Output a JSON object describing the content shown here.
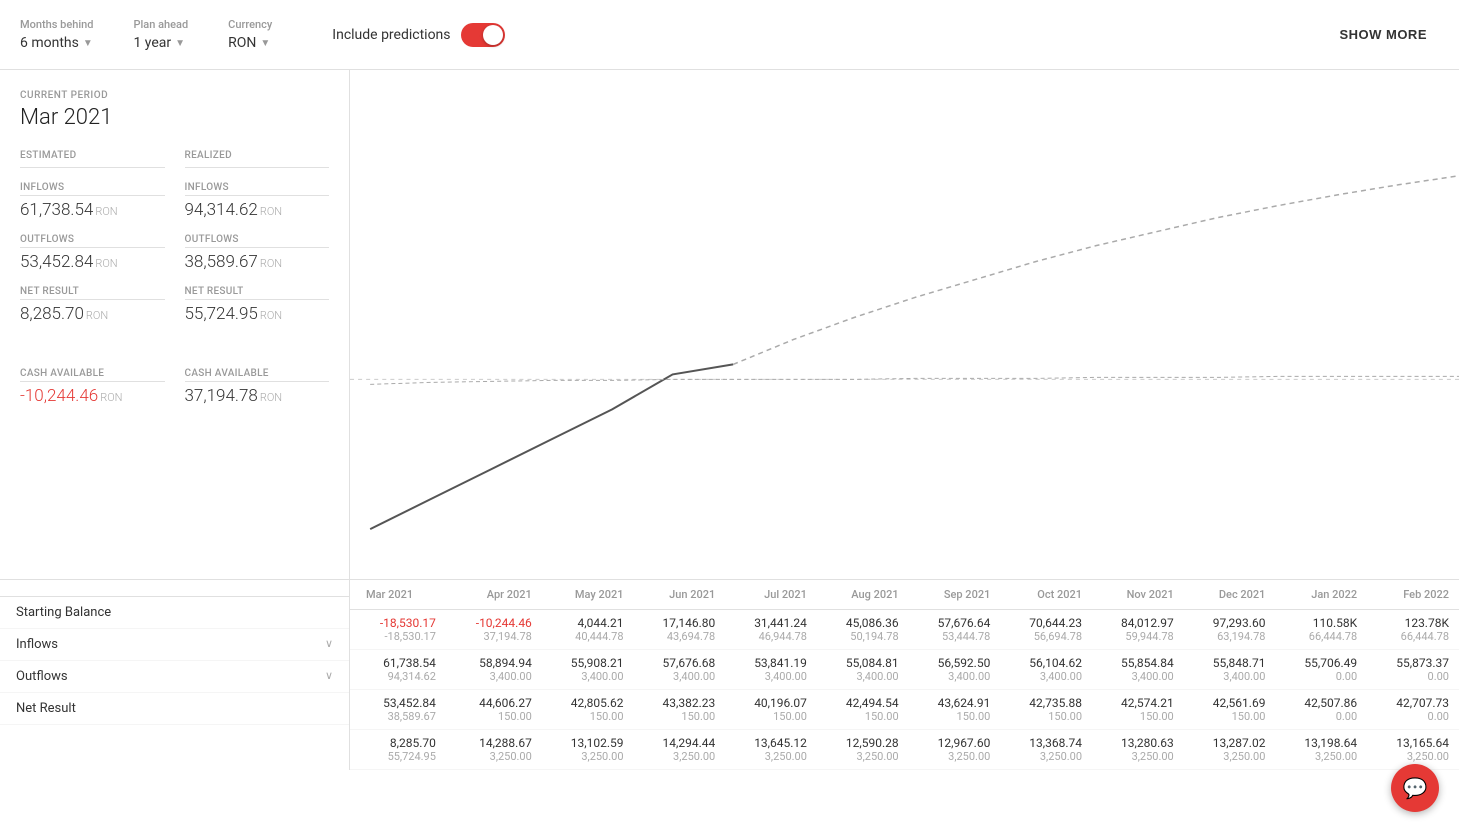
{
  "topbar": {
    "months_behind_label": "Months behind",
    "months_behind_value": "6 months",
    "plan_ahead_label": "Plan ahead",
    "plan_ahead_value": "1 year",
    "currency_label": "Currency",
    "currency_value": "RON",
    "include_predictions_label": "Include predictions",
    "show_more_label": "SHOW MORE"
  },
  "left_panel": {
    "current_period_label": "CURRENT PERIOD",
    "current_period_value": "Mar 2021",
    "estimated_label": "ESTIMATED",
    "realized_label": "REALIZED",
    "est_inflows_label": "INFLOWS",
    "est_inflows_value": "61,738.54",
    "est_inflows_currency": "RON",
    "est_outflows_label": "OUTFLOWS",
    "est_outflows_value": "53,452.84",
    "est_outflows_currency": "RON",
    "est_net_label": "NET RESULT",
    "est_net_value": "8,285.70",
    "est_net_currency": "RON",
    "est_cash_label": "CASH AVAILABLE",
    "est_cash_value": "-10,244.46",
    "est_cash_currency": "RON",
    "real_inflows_label": "INFLOWS",
    "real_inflows_value": "94,314.62",
    "real_inflows_currency": "RON",
    "real_outflows_label": "OUTFLOWS",
    "real_outflows_value": "38,589.67",
    "real_outflows_currency": "RON",
    "real_net_label": "NET RESULT",
    "real_net_value": "55,724.95",
    "real_net_currency": "RON",
    "real_cash_label": "CASH AVAILABLE",
    "real_cash_value": "37,194.78",
    "real_cash_currency": "RON"
  },
  "table": {
    "columns": [
      "Mar 2021",
      "Apr 2021",
      "May 2021",
      "Jun 2021",
      "Jul 2021",
      "Aug 2021",
      "Sep 2021",
      "Oct 2021",
      "Nov 2021",
      "Dec 2021",
      "Jan 2022",
      "Feb 2022"
    ],
    "rows": {
      "starting_balance": {
        "label": "Starting Balance",
        "data": [
          [
            "-18,530.17",
            "-18,530.17"
          ],
          [
            "-10,244.46",
            "37,194.78"
          ],
          [
            "4,044.21",
            "40,444.78"
          ],
          [
            "17,146.80",
            "43,694.78"
          ],
          [
            "31,441.24",
            "46,944.78"
          ],
          [
            "45,086.36",
            "50,194.78"
          ],
          [
            "57,676.64",
            "53,444.78"
          ],
          [
            "70,644.23",
            "56,694.78"
          ],
          [
            "84,012.97",
            "59,944.78"
          ],
          [
            "97,293.60",
            "63,194.78"
          ],
          [
            "110.58K",
            "66,444.78"
          ],
          [
            "123.78K",
            "66,444.78"
          ]
        ]
      },
      "inflows": {
        "label": "Inflows",
        "data": [
          [
            "61,738.54",
            "94,314.62"
          ],
          [
            "58,894.94",
            "3,400.00"
          ],
          [
            "55,908.21",
            "3,400.00"
          ],
          [
            "57,676.68",
            "3,400.00"
          ],
          [
            "53,841.19",
            "3,400.00"
          ],
          [
            "55,084.81",
            "3,400.00"
          ],
          [
            "56,592.50",
            "3,400.00"
          ],
          [
            "56,104.62",
            "3,400.00"
          ],
          [
            "55,854.84",
            "3,400.00"
          ],
          [
            "55,848.71",
            "3,400.00"
          ],
          [
            "55,706.49",
            "0.00"
          ],
          [
            "55,873.37",
            "0.00"
          ]
        ]
      },
      "outflows": {
        "label": "Outflows",
        "data": [
          [
            "53,452.84",
            "38,589.67"
          ],
          [
            "44,606.27",
            "150.00"
          ],
          [
            "42,805.62",
            "150.00"
          ],
          [
            "43,382.23",
            "150.00"
          ],
          [
            "40,196.07",
            "150.00"
          ],
          [
            "42,494.54",
            "150.00"
          ],
          [
            "43,624.91",
            "150.00"
          ],
          [
            "42,735.88",
            "150.00"
          ],
          [
            "42,574.21",
            "150.00"
          ],
          [
            "42,561.69",
            "150.00"
          ],
          [
            "42,507.86",
            "0.00"
          ],
          [
            "42,707.73",
            "0.00"
          ]
        ]
      },
      "net_result": {
        "label": "Net Result",
        "data": [
          [
            "8,285.70",
            "55,724.95"
          ],
          [
            "14,288.67",
            "3,250.00"
          ],
          [
            "13,102.59",
            "3,250.00"
          ],
          [
            "14,294.44",
            "3,250.00"
          ],
          [
            "13,645.12",
            "3,250.00"
          ],
          [
            "12,590.28",
            "3,250.00"
          ],
          [
            "12,967.60",
            "3,250.00"
          ],
          [
            "13,368.74",
            "3,250.00"
          ],
          [
            "13,280.63",
            "3,250.00"
          ],
          [
            "13,287.02",
            "3,250.00"
          ],
          [
            "13,198.64",
            "3,250.00"
          ],
          [
            "13,165.64",
            "3,250.00"
          ]
        ]
      }
    }
  },
  "chart": {
    "solid_line_color": "#555",
    "dashed_line_color": "#aaa",
    "horizontal_line_color": "#ccc"
  }
}
